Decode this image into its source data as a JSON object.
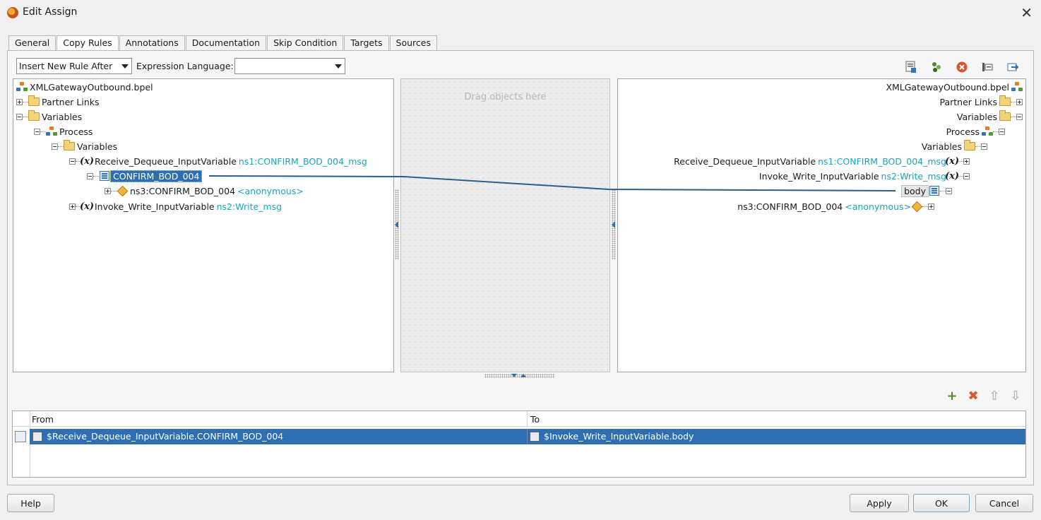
{
  "window": {
    "title": "Edit Assign",
    "close_glyph": "✕"
  },
  "tabs": [
    {
      "label": "General"
    },
    {
      "label": "Copy Rules"
    },
    {
      "label": "Annotations"
    },
    {
      "label": "Documentation"
    },
    {
      "label": "Skip Condition"
    },
    {
      "label": "Targets"
    },
    {
      "label": "Sources"
    }
  ],
  "active_tab": "Copy Rules",
  "controls": {
    "insert_mode": "Insert New Rule After",
    "expression_language_label": "Expression Language:",
    "expression_language_value": ""
  },
  "middle": {
    "placeholder": "Drag objects here"
  },
  "source_tree": {
    "root": "XMLGatewayOutbound.bpel",
    "partner_links": "Partner Links",
    "variables": "Variables",
    "process": "Process",
    "process_variables": "Variables",
    "receive_var": "Receive_Dequeue_InputVariable",
    "receive_var_type": "ns1:CONFIRM_BOD_004_msg",
    "confirm_part": "CONFIRM_BOD_004",
    "confirm_elem": "ns3:CONFIRM_BOD_004",
    "confirm_elem_type": "<anonymous>",
    "invoke_var": "Invoke_Write_InputVariable",
    "invoke_var_type": "ns2:Write_msg"
  },
  "target_tree": {
    "root": "XMLGatewayOutbound.bpel",
    "partner_links": "Partner Links",
    "variables": "Variables",
    "process": "Process",
    "process_variables": "Variables",
    "receive_var": "Receive_Dequeue_InputVariable",
    "receive_var_type": "ns1:CONFIRM_BOD_004_msg",
    "invoke_var": "Invoke_Write_InputVariable",
    "invoke_var_type": "ns2:Write_msg",
    "body_part": "body",
    "body_elem": "ns3:CONFIRM_BOD_004",
    "body_elem_type": "<anonymous>"
  },
  "copy_rules": {
    "columns": {
      "from": "From",
      "to": "To"
    },
    "rows": [
      {
        "from": "$Receive_Dequeue_InputVariable.CONFIRM_BOD_004",
        "to": "$Invoke_Write_InputVariable.body"
      }
    ]
  },
  "buttons": {
    "help": "Help",
    "apply": "Apply",
    "ok": "OK",
    "cancel": "Cancel"
  },
  "colors": {
    "selection": "#2d6fb0",
    "namespace": "#18a6c0",
    "link_line": "#2b5d8c"
  },
  "icons": {
    "toolbar": [
      "xpath-expression-icon",
      "bind-icon",
      "remove-icon",
      "literal-icon",
      "append-icon"
    ],
    "rule_actions": [
      "add-icon",
      "delete-icon",
      "move-up-icon",
      "move-down-icon"
    ]
  }
}
